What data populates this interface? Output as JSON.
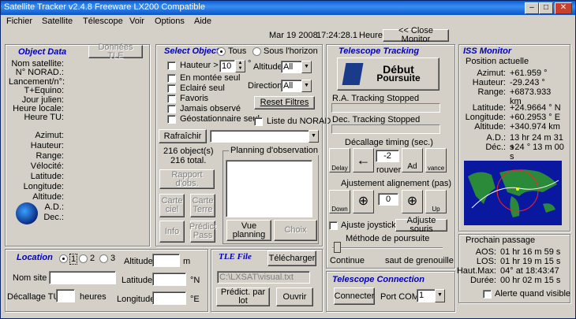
{
  "window": {
    "title": "Satellite Tracker v2.4.8 Freeware      LX200 Compatible",
    "buttons": {
      "minimize": "–",
      "maximize": "□",
      "close": "✕"
    }
  },
  "menu": [
    "Fichier",
    "Satellite",
    "Télescope",
    "Voir",
    "Options",
    "Aide"
  ],
  "header": {
    "date": "Mar 19 2008",
    "time": "17:24:28.1",
    "heure_label": "Heure",
    "close_monitor": "<< Close Monitor"
  },
  "object_data": {
    "title": "Object Data",
    "tle_button": "Données TLE",
    "labels": [
      "Nom satellite:",
      "N° NORAD.:",
      "Lancement/n°:",
      "T+Equino:",
      "Jour julien:",
      "Heure locale:",
      "Heure TU:"
    ],
    "labels2": [
      "Azimut:",
      "Hauteur:",
      "Range:",
      "Vélocité:",
      "Latitude:",
      "Longitude:",
      "Altitude:",
      "A.D.:",
      "Dec.:"
    ]
  },
  "select_object": {
    "title": "Select Object",
    "radio_all": "Tous",
    "radio_horizon": "Sous l'horizon",
    "hauteur_label": "Hauteur >",
    "hauteur_value": "10",
    "hauteur_unit": "°",
    "altitude_label": "Altitude",
    "altitude_value": "All",
    "direction_label": "Direction",
    "direction_value": "All",
    "checks": [
      "En montée seul",
      "Eclairé seul",
      "Favoris",
      "Jamais observé",
      "Géostationnaire seul"
    ],
    "reset": "Reset Filtres",
    "norad_check": "Liste du NORAD",
    "refresh": "Rafraîchir",
    "objects_count": "216 object(s)",
    "total": "216 total.",
    "btn_rapport": "Rapport d'obs.",
    "btn_carte_ciel": "Carte ciel",
    "btn_carte_terre": "Carte Terre",
    "btn_info": "Info",
    "btn_predict": "Prédict Pass",
    "planning_title": "Planning d'observation",
    "btn_vue": "Vue planning",
    "btn_choix": "Choix"
  },
  "telescope_tracking": {
    "title": "Telescope Tracking",
    "start_top": "Début",
    "start_bottom": "Poursuite",
    "ra_status": "R.A. Tracking Stopped",
    "dec_status": "Dec. Tracking Stopped",
    "timing_label": "Décallage timing (sec.)",
    "timing_value": "-2",
    "delay": "Delay",
    "retard": "rouver",
    "ad": "Ad",
    "avance": "vance",
    "align_label": "Ajustement alignement (pas)",
    "align_value": "0",
    "down": "Down",
    "up": "Up",
    "joystick": "Ajuste joystick",
    "mouse": "Adjuste souris",
    "method_label": "Méthode de poursuite",
    "continue": "Continue",
    "saut": "saut de grenouille"
  },
  "iss_monitor": {
    "title": "ISS Monitor",
    "position_label": "Position actuelle",
    "rows": [
      {
        "label": "Azimut:",
        "value": "+61.959 °"
      },
      {
        "label": "Hauteur:",
        "value": "-29.243 °"
      },
      {
        "label": "Range:",
        "value": "+6873.933 km"
      },
      {
        "label": "Latitude:",
        "value": "+24.9664 ° N"
      },
      {
        "label": "Longitude:",
        "value": "+60.2953 ° E"
      },
      {
        "label": "Altitude:",
        "value": "+340.974 km"
      },
      {
        "label": "A.D.:",
        "value": "13 hr 24 m 31 s"
      },
      {
        "label": "Déc.:",
        "value": "+24 ° 13 m 00 s"
      }
    ],
    "pass_label": "Prochain passage",
    "pass": [
      {
        "label": "AOS:",
        "value": "01 hr 16 m 59 s"
      },
      {
        "label": "LOS:",
        "value": "01 hr 19 m 15 s"
      },
      {
        "label": "Haut.Max:",
        "value": "04° at 18:43:47"
      },
      {
        "label": "Durée:",
        "value": "00 hr 02 m 15 s"
      }
    ],
    "alert": "Alerte quand visible"
  },
  "location": {
    "title": "Location",
    "radios": [
      "1",
      "2",
      "3"
    ],
    "altitude_label": "Altitude",
    "altitude_unit": "m",
    "nom_label": "Nom site",
    "latitude_label": "Latitude",
    "latitude_unit": "°N",
    "tz_label": "Décallage TU",
    "tz_unit": "heures",
    "longitude_label": "Longitude",
    "longitude_unit": "°E"
  },
  "tle_file": {
    "title": "TLE File",
    "load": "Télécharger",
    "path": "C:\\LXSAT\\visual.txt",
    "predict": "Prédict. par lot",
    "open": "Ouvrir"
  },
  "telescope_connection": {
    "title": "Telescope Connection",
    "connect": "Connecter",
    "port_label": "Port COM",
    "port_value": "1"
  }
}
